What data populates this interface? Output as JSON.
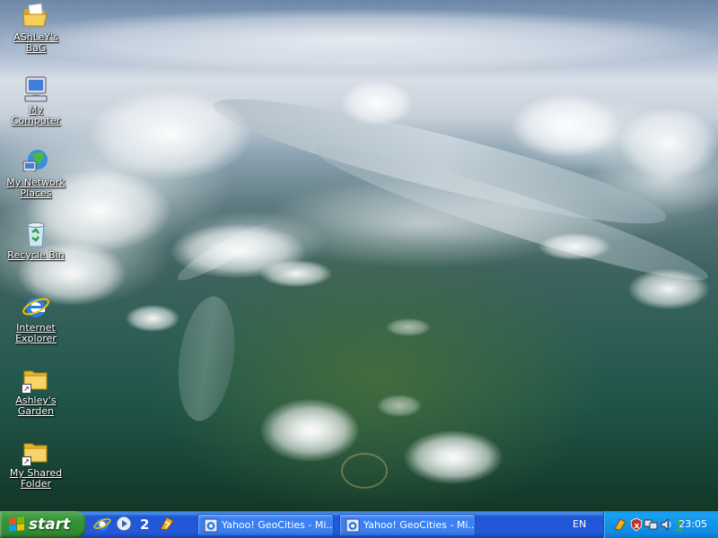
{
  "desktop": {
    "icons": [
      {
        "name": "ashleys-bag",
        "label": "AShLeY's BaG",
        "icon": "open-folder-icon"
      },
      {
        "name": "my-computer",
        "label": "My Computer",
        "icon": "my-computer-icon"
      },
      {
        "name": "my-network-places",
        "label": "My Network Places",
        "icon": "network-places-icon"
      },
      {
        "name": "recycle-bin",
        "label": "Recycle Bin",
        "icon": "recycle-bin-icon"
      },
      {
        "name": "internet-explorer",
        "label": "Internet Explorer",
        "icon": "internet-explorer-icon"
      },
      {
        "name": "ashleys-garden",
        "label": "Ashley's Garden",
        "icon": "folder-shortcut-icon"
      },
      {
        "name": "my-shared-folder",
        "label": "My Shared Folder",
        "icon": "folder-shortcut-icon"
      }
    ]
  },
  "taskbar": {
    "start_label": "start",
    "quick_launch": [
      "internet-explorer-icon",
      "windows-media-player-icon",
      "msn-messenger-icon",
      "winamp-icon"
    ],
    "tasks": [
      {
        "label": "Yahoo! GeoCities - Mi...",
        "icon": "internet-explorer-icon"
      },
      {
        "label": "Yahoo! GeoCities - Mi...",
        "icon": "internet-explorer-icon"
      }
    ],
    "language": "EN",
    "tray_icons": [
      "winamp-agent-icon",
      "security-alert-icon",
      "network-icon",
      "volume-icon",
      "messenger-icon"
    ],
    "clock": "23:05"
  },
  "colors": {
    "taskbar_blue": "#2459d8",
    "start_green": "#37953a",
    "tray_blue": "#0f8ae3"
  }
}
